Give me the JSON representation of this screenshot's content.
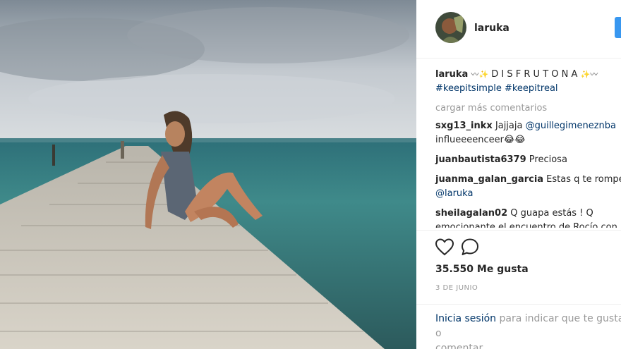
{
  "post": {
    "username": "laruka",
    "caption": {
      "user": "laruka",
      "wave": "〰",
      "sparkle": "✨",
      "text": " D I S F R U T O N A ",
      "hashtags": [
        "#keepitsimple",
        "#keepitreal"
      ]
    },
    "load_more": "cargar más comentarios",
    "comments": [
      {
        "user": "sxg13_inkx",
        "text": " Jajjaja ",
        "mention": "@guillegimeneznba",
        "text2": "influeeeenceer😂😂"
      },
      {
        "user": "juanbautista6379",
        "text": " Preciosa"
      },
      {
        "user": "juanma_galan_garcia",
        "text": " Estas q te rompes",
        "mention": "@laruka"
      },
      {
        "user": "sheilagalan02",
        "text": " Q guapa estás ! Q",
        "text2": "emocionante el encuentro de Rocío con"
      }
    ],
    "likes": "35.550 Me gusta",
    "date": "3 DE JUNIO",
    "login_link": "Inicia sesión",
    "login_text": " para indicar que te gusta o",
    "login_text2": "comentar."
  },
  "icons": {
    "like": "heart-icon",
    "comment": "comment-icon"
  },
  "colors": {
    "link": "#003569",
    "follow": "#3897f0",
    "muted": "#999999"
  }
}
